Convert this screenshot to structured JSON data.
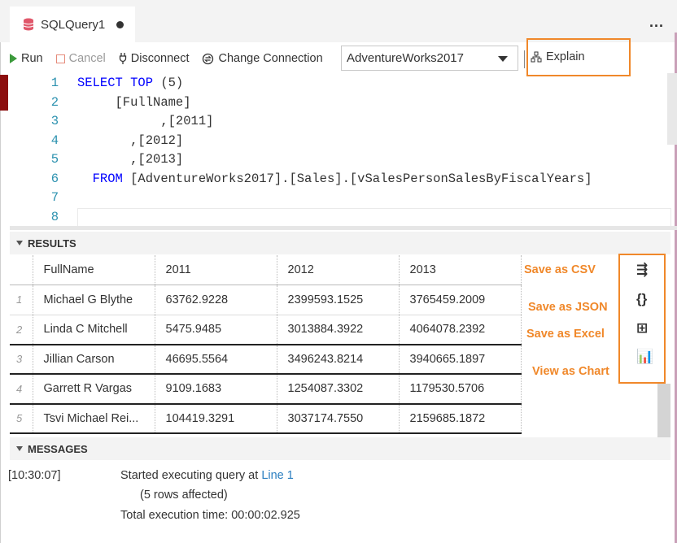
{
  "tab": {
    "title": "SQLQuery1",
    "more": "..."
  },
  "toolbar": {
    "run": "Run",
    "cancel": "Cancel",
    "disconnect": "Disconnect",
    "change_connection": "Change Connection",
    "database": "AdventureWorks2017",
    "explain": "Explain"
  },
  "editor": {
    "lines": [
      {
        "n": "1",
        "parts": [
          {
            "t": "SELECT TOP ",
            "c": "kw"
          },
          {
            "t": "(5)",
            "c": ""
          }
        ]
      },
      {
        "n": "2",
        "parts": [
          {
            "t": "     [FullName]",
            "c": ""
          }
        ]
      },
      {
        "n": "3",
        "parts": [
          {
            "t": "           ,[2011]",
            "c": ""
          }
        ]
      },
      {
        "n": "4",
        "parts": [
          {
            "t": "       ,[2012]",
            "c": ""
          }
        ]
      },
      {
        "n": "5",
        "parts": [
          {
            "t": "       ,[2013]",
            "c": ""
          }
        ]
      },
      {
        "n": "6",
        "parts": [
          {
            "t": "  FROM ",
            "c": "kw"
          },
          {
            "t": "[AdventureWorks2017].[Sales].[vSalesPersonSalesByFiscalYears]",
            "c": ""
          }
        ]
      },
      {
        "n": "7",
        "parts": []
      },
      {
        "n": "8",
        "parts": []
      }
    ]
  },
  "results": {
    "header": "RESULTS",
    "columns": [
      "FullName",
      "2011",
      "2012",
      "2013"
    ],
    "rows": [
      {
        "n": "1",
        "cells": [
          "Michael G Blythe",
          "63762.9228",
          "2399593.1525",
          "3765459.2009"
        ]
      },
      {
        "n": "2",
        "cells": [
          "Linda C Mitchell",
          "5475.9485",
          "3013884.3922",
          "4064078.2392"
        ]
      },
      {
        "n": "3",
        "cells": [
          "Jillian  Carson",
          "46695.5564",
          "3496243.8214",
          "3940665.1897"
        ]
      },
      {
        "n": "4",
        "cells": [
          "Garrett R Vargas",
          "9109.1683",
          "1254087.3302",
          "1179530.5706"
        ]
      },
      {
        "n": "5",
        "cells": [
          "Tsvi Michael Rei...",
          "104419.3291",
          "3037174.7550",
          "2159685.1872"
        ]
      }
    ],
    "actions": {
      "csv": "Save as CSV",
      "json": "Save as JSON",
      "excel": "Save as Excel",
      "chart": "View as Chart"
    }
  },
  "messages": {
    "header": "MESSAGES",
    "timestamp": "[10:30:07]",
    "started": "Started executing query at ",
    "line_link": "Line 1",
    "rows_affected": "(5 rows affected)",
    "total_time": "Total execution time: 00:00:02.925"
  },
  "colors": {
    "accent_highlight": "#f0882a",
    "keyword": "#0000ff",
    "line_number": "#2b91af",
    "link": "#2a7ec0"
  }
}
